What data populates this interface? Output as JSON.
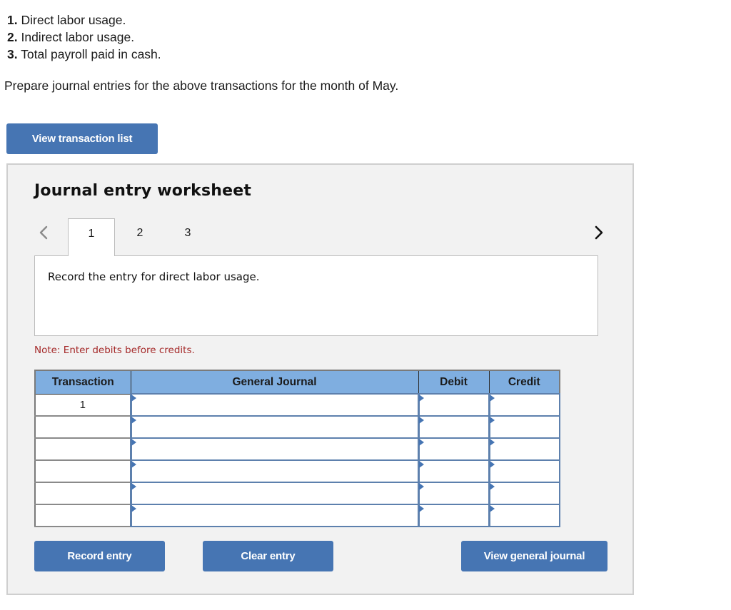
{
  "transactions": [
    {
      "num": "1.",
      "text": "Direct labor usage."
    },
    {
      "num": "2.",
      "text": "Indirect labor usage."
    },
    {
      "num": "3.",
      "text": "Total payroll paid in cash."
    }
  ],
  "prompt": "Prepare journal entries for the above transactions for the month of May.",
  "view_transaction_list_label": "View transaction list",
  "worksheet": {
    "title": "Journal entry worksheet",
    "tabs": [
      {
        "label": "1",
        "active": true
      },
      {
        "label": "2",
        "active": false
      },
      {
        "label": "3",
        "active": false
      }
    ],
    "description": "Record the entry for direct labor usage.",
    "note": "Note: Enter debits before credits.",
    "table": {
      "headers": [
        "Transaction",
        "General Journal",
        "Debit",
        "Credit"
      ],
      "rows": [
        {
          "transaction": "1",
          "account": "",
          "debit": "",
          "credit": ""
        },
        {
          "transaction": "",
          "account": "",
          "debit": "",
          "credit": ""
        },
        {
          "transaction": "",
          "account": "",
          "debit": "",
          "credit": ""
        },
        {
          "transaction": "",
          "account": "",
          "debit": "",
          "credit": ""
        },
        {
          "transaction": "",
          "account": "",
          "debit": "",
          "credit": ""
        },
        {
          "transaction": "",
          "account": "",
          "debit": "",
          "credit": ""
        }
      ]
    },
    "buttons": {
      "record": "Record entry",
      "clear": "Clear entry",
      "view_general_journal": "View general journal"
    },
    "icons": {
      "prev": "chevron-left-icon",
      "next": "chevron-right-icon"
    }
  },
  "colors": {
    "button": "#4675b3",
    "table_header": "#7faee0",
    "note": "#a52a2a",
    "panel_bg": "#f2f2f2"
  }
}
